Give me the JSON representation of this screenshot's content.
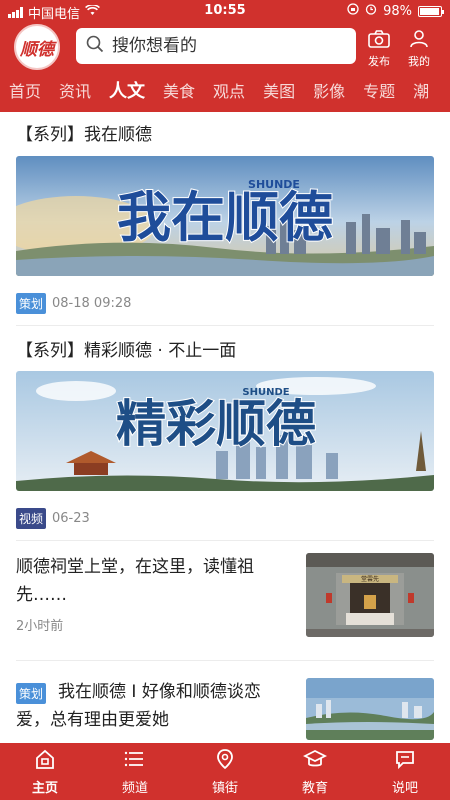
{
  "status_bar": {
    "carrier": "中国电信",
    "time": "10:55",
    "battery": "98%"
  },
  "header": {
    "logo_text": "顺德",
    "search_placeholder": "搜你想看的",
    "publish_label": "发布",
    "mine_label": "我的"
  },
  "nav": {
    "tabs": [
      "首页",
      "资讯",
      "人文",
      "美食",
      "观点",
      "美图",
      "影像",
      "专题",
      "潮"
    ],
    "active": "人文"
  },
  "feed": {
    "item1": {
      "title": "【系列】我在顺德",
      "banner_text": "我在顺德",
      "banner_sub": "SHUNDE",
      "badge": "策划",
      "time": "08-18 09:28"
    },
    "item2": {
      "title": "【系列】精彩顺德 · 不止一面",
      "banner_text": "精彩顺德",
      "banner_sub": "SHUNDE",
      "badge": "视频",
      "time": "06-23"
    },
    "item3": {
      "title": "顺德祠堂上堂，在这里，读懂祖先……",
      "time": "2小时前",
      "thumb_sign": "堂雲先"
    },
    "item4": {
      "badge": "策划",
      "title": "我在顺德 I 好像和顺德谈恋爱，总有理由更爱她"
    }
  },
  "tabbar": {
    "items": [
      "主页",
      "频道",
      "镇街",
      "教育",
      "说吧"
    ],
    "active": "主页"
  },
  "colors": {
    "brand_red": "#d0312d",
    "badge_plan": "#4a90d9",
    "badge_video": "#3a4a8a"
  }
}
